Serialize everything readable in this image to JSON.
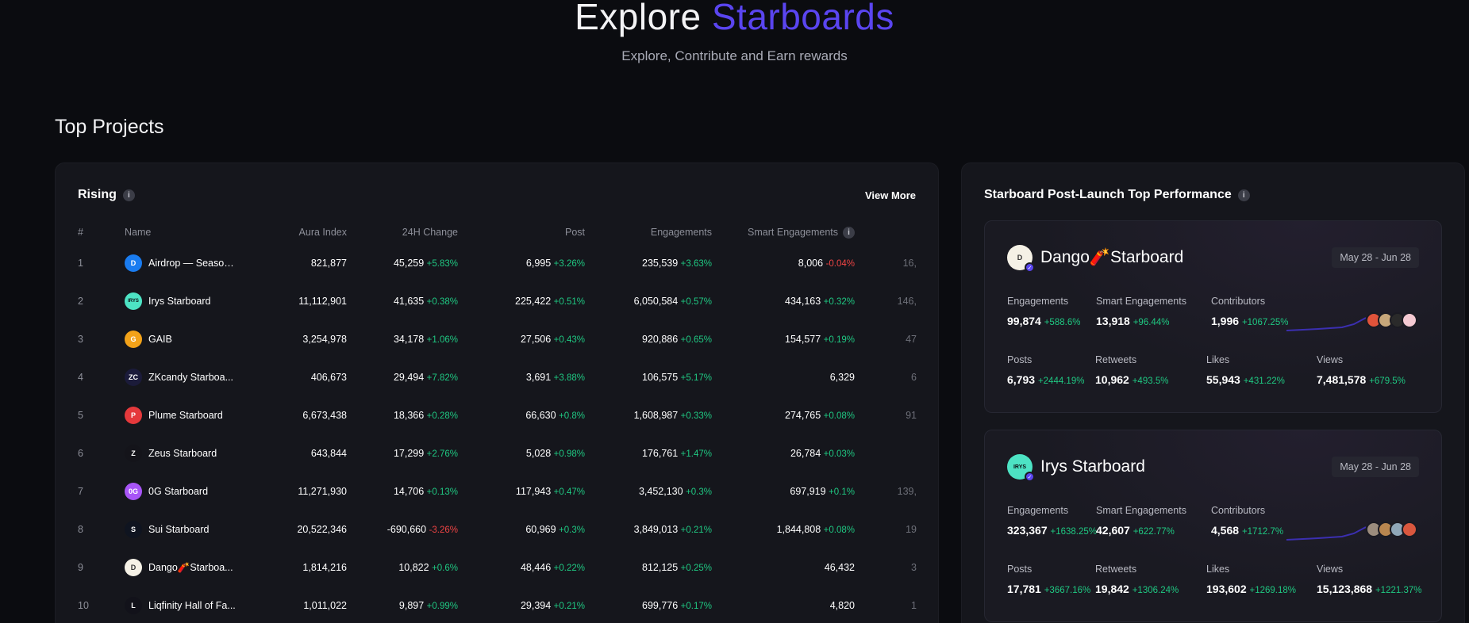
{
  "hero": {
    "title_main": "Explore",
    "title_accent": "Starboards",
    "subtitle": "Explore, Contribute and Earn rewards"
  },
  "section_title": "Top Projects",
  "rising": {
    "title": "Rising",
    "view_more": "View More",
    "columns": [
      "#",
      "Name",
      "Aura Index",
      "24H Change",
      "Post",
      "Engagements",
      "Smart Engagements"
    ],
    "rows": [
      {
        "rank": "1",
        "name": "Airdrop — Season ...",
        "aura": "821,877",
        "ch": "45,259",
        "ch_pct": "+5.83%",
        "post": "6,995",
        "post_pct": "+3.26%",
        "eng": "235,539",
        "eng_pct": "+3.63%",
        "smart": "8,006",
        "smart_pct": "-0.04%",
        "extra": "16,",
        "logo_color": "#1a7cf0",
        "logo_text": "D"
      },
      {
        "rank": "2",
        "name": "Irys Starboard",
        "aura": "11,112,901",
        "ch": "41,635",
        "ch_pct": "+0.38%",
        "post": "225,422",
        "post_pct": "+0.51%",
        "eng": "6,050,584",
        "eng_pct": "+0.57%",
        "smart": "434,163",
        "smart_pct": "+0.32%",
        "extra": "146,",
        "logo_color": "#4de3c4",
        "logo_text": "IRYS"
      },
      {
        "rank": "3",
        "name": "GAIB",
        "aura": "3,254,978",
        "ch": "34,178",
        "ch_pct": "+1.06%",
        "post": "27,506",
        "post_pct": "+0.43%",
        "eng": "920,886",
        "eng_pct": "+0.65%",
        "smart": "154,577",
        "smart_pct": "+0.19%",
        "extra": "47",
        "logo_color": "#f2a219",
        "logo_text": "G"
      },
      {
        "rank": "4",
        "name": "ZKcandy Starboa...",
        "aura": "406,673",
        "ch": "29,494",
        "ch_pct": "+7.82%",
        "post": "3,691",
        "post_pct": "+3.88%",
        "eng": "106,575",
        "eng_pct": "+5.17%",
        "smart": "6,329",
        "smart_pct": "",
        "extra": "6",
        "logo_color": "#1b1b3a",
        "logo_text": "ZC"
      },
      {
        "rank": "5",
        "name": "Plume Starboard",
        "aura": "6,673,438",
        "ch": "18,366",
        "ch_pct": "+0.28%",
        "post": "66,630",
        "post_pct": "+0.8%",
        "eng": "1,608,987",
        "eng_pct": "+0.33%",
        "smart": "274,765",
        "smart_pct": "+0.08%",
        "extra": "91",
        "logo_color": "#e5393c",
        "logo_text": "P"
      },
      {
        "rank": "6",
        "name": "Zeus Starboard",
        "aura": "643,844",
        "ch": "17,299",
        "ch_pct": "+2.76%",
        "post": "5,028",
        "post_pct": "+0.98%",
        "eng": "176,761",
        "eng_pct": "+1.47%",
        "smart": "26,784",
        "smart_pct": "+0.03%",
        "extra": "",
        "logo_color": "#14141a",
        "logo_text": "Z"
      },
      {
        "rank": "7",
        "name": "0G Starboard",
        "aura": "11,271,930",
        "ch": "14,706",
        "ch_pct": "+0.13%",
        "post": "117,943",
        "post_pct": "+0.47%",
        "eng": "3,452,130",
        "eng_pct": "+0.3%",
        "smart": "697,919",
        "smart_pct": "+0.1%",
        "extra": "139,",
        "logo_color": "#a855f7",
        "logo_text": "0G"
      },
      {
        "rank": "8",
        "name": "Sui Starboard",
        "aura": "20,522,346",
        "ch": "-690,660",
        "ch_pct": "-3.26%",
        "post": "60,969",
        "post_pct": "+0.3%",
        "eng": "3,849,013",
        "eng_pct": "+0.21%",
        "smart": "1,844,808",
        "smart_pct": "+0.08%",
        "extra": "19",
        "logo_color": "#0f1420",
        "logo_text": "S"
      },
      {
        "rank": "9",
        "name": "Dango🧨Starboa...",
        "aura": "1,814,216",
        "ch": "10,822",
        "ch_pct": "+0.6%",
        "post": "48,446",
        "post_pct": "+0.22%",
        "eng": "812,125",
        "eng_pct": "+0.25%",
        "smart": "46,432",
        "smart_pct": "",
        "extra": "3",
        "logo_color": "#f5f1e6",
        "logo_text": "D"
      },
      {
        "rank": "10",
        "name": "Liqfinity Hall of Fa...",
        "aura": "1,011,022",
        "ch": "9,897",
        "ch_pct": "+0.99%",
        "post": "29,394",
        "post_pct": "+0.21%",
        "eng": "699,776",
        "eng_pct": "+0.17%",
        "smart": "4,820",
        "smart_pct": "",
        "extra": "1",
        "logo_color": "#12121a",
        "logo_text": "L"
      }
    ]
  },
  "performance": {
    "title": "Starboard Post-Launch Top Performance",
    "cards": [
      {
        "name": "Dango🧨Starboard",
        "date": "May 28 - Jun 28",
        "labels": {
          "engagements": "Engagements",
          "smart": "Smart Engagements",
          "contributors": "Contributors",
          "posts": "Posts",
          "retweets": "Retweets",
          "likes": "Likes",
          "views": "Views"
        },
        "engagements": "99,874",
        "engagements_pct": "+588.6%",
        "smart": "13,918",
        "smart_pct": "+96.44%",
        "contributors": "1,996",
        "contributors_pct": "+1067.25%",
        "posts": "6,793",
        "posts_pct": "+2444.19%",
        "retweets": "10,962",
        "retweets_pct": "+493.5%",
        "likes": "55,943",
        "likes_pct": "+431.22%",
        "views": "7,481,578",
        "views_pct": "+679.5%"
      },
      {
        "name": "Irys Starboard",
        "date": "May 28 - Jun 28",
        "labels": {
          "engagements": "Engagements",
          "smart": "Smart Engagements",
          "contributors": "Contributors",
          "posts": "Posts",
          "retweets": "Retweets",
          "likes": "Likes",
          "views": "Views"
        },
        "engagements": "323,367",
        "engagements_pct": "+1638.25%",
        "smart": "42,607",
        "smart_pct": "+622.77%",
        "contributors": "4,568",
        "contributors_pct": "+1712.7%",
        "posts": "17,781",
        "posts_pct": "+3667.16%",
        "retweets": "19,842",
        "retweets_pct": "+1306.24%",
        "likes": "193,602",
        "likes_pct": "+1269.18%",
        "views": "15,123,868",
        "views_pct": "+1221.37%"
      }
    ]
  },
  "colors": {
    "accent": "#5a45f0",
    "positive": "#1fc882",
    "negative": "#ef4444",
    "background": "#0b0c10",
    "panel": "#15161c"
  }
}
